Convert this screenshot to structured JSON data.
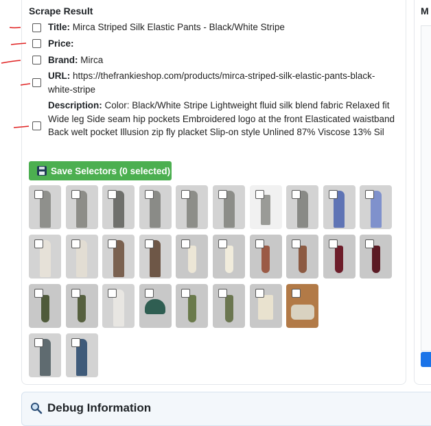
{
  "scrape": {
    "title": "Scrape Result",
    "fields": [
      {
        "key": "Title:",
        "value": "Mirca Striped Silk Elastic Pants - Black/White Stripe"
      },
      {
        "key": "Price:",
        "value": ""
      },
      {
        "key": "Brand:",
        "value": "Mirca"
      },
      {
        "key": "URL:",
        "value": "https://thefrankieshop.com/products/mirca-striped-silk-elastic-pants-black-white-stripe"
      },
      {
        "key": "Description:",
        "value": "Color: Black/White Stripe Lightweight fluid silk blend fabric Relaxed fit Wide leg Side seam hip pockets Embroidered logo at the front Elasticated waistband Back welt pocket Illusion zip fly placket Slip-on style Unlined 87% Viscose 13% Sil"
      }
    ],
    "save_button": "Save Selectors (0 selected)"
  },
  "images": [
    {
      "kind": "person",
      "color": "#8f908c"
    },
    {
      "kind": "person",
      "color": "#8d8d88"
    },
    {
      "kind": "person",
      "color": "#6f706c"
    },
    {
      "kind": "person",
      "color": "#8a8b87"
    },
    {
      "kind": "person",
      "color": "#8d8e89"
    },
    {
      "kind": "person",
      "color": "#8c8d88"
    },
    {
      "kind": "pants",
      "color": "#9a9b97"
    },
    {
      "kind": "person",
      "color": "#898a86"
    },
    {
      "kind": "person",
      "color": "#5f74b5"
    },
    {
      "kind": "person",
      "color": "#7f91cc"
    },
    {
      "kind": "person",
      "color": "#e6e1d8"
    },
    {
      "kind": "person",
      "color": "#e2ddd3"
    },
    {
      "kind": "person",
      "color": "#7a6150"
    },
    {
      "kind": "person",
      "color": "#6e5747"
    },
    {
      "kind": "socks",
      "color": "#ece6d6"
    },
    {
      "kind": "socks",
      "color": "#f1ecdc"
    },
    {
      "kind": "socks",
      "color": "#9b5a45"
    },
    {
      "kind": "socks",
      "color": "#8c5a42"
    },
    {
      "kind": "socks",
      "color": "#6d1d2a"
    },
    {
      "kind": "socks",
      "color": "#5b1a24"
    },
    {
      "kind": "socks",
      "color": "#4f5a3a"
    },
    {
      "kind": "socks",
      "color": "#56603f"
    },
    {
      "kind": "person",
      "color": "#e8e6e2"
    },
    {
      "kind": "cap",
      "color": "#2f5e52"
    },
    {
      "kind": "socks",
      "color": "#6a7a4b"
    },
    {
      "kind": "socks",
      "color": "#6b7650"
    },
    {
      "kind": "box",
      "color": "#e9e2cf"
    },
    {
      "kind": "shoes",
      "color": "#d9d2c1"
    },
    {
      "kind": "person",
      "color": "#5f6b70"
    },
    {
      "kind": "person",
      "color": "#3f5b7a"
    }
  ],
  "right_panel": {
    "title": "M"
  },
  "debug": {
    "title": "Debug Information"
  }
}
